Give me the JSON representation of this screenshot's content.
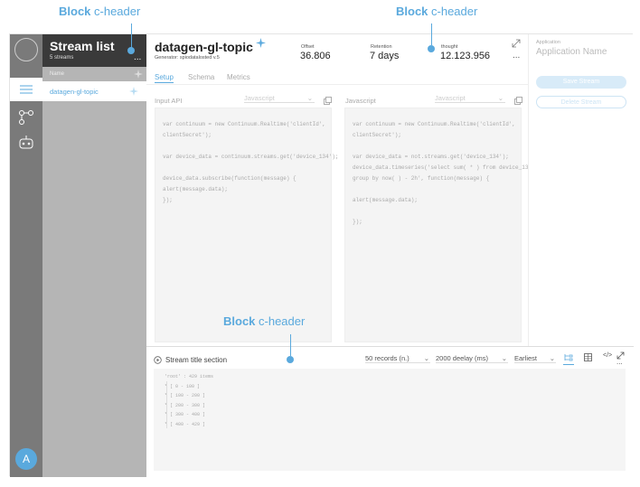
{
  "annotations": {
    "block_label_1": {
      "strong": "Block",
      "rest": " c-header"
    },
    "block_label_2": {
      "strong": "Block",
      "rest": " c-header"
    },
    "block_label_3": {
      "strong": "Block",
      "rest": " c-header"
    }
  },
  "rail": {
    "avatar_letter": "A"
  },
  "sidebar": {
    "title": "Stream list",
    "count": "5 streams",
    "more": "...",
    "column_header": "Name",
    "items": [
      {
        "label": "datagen-gl-topic"
      }
    ]
  },
  "header": {
    "topic": "datagen-gl-topic",
    "generator": "Generator: spiodatalosted v.5",
    "stats": [
      {
        "label": "Offset",
        "value": "36.806"
      },
      {
        "label": "Retention",
        "value": "7 days"
      },
      {
        "label": "thought",
        "value": "12.123.956"
      }
    ],
    "more": "..."
  },
  "tabs": [
    {
      "label": "Setup",
      "active": true
    },
    {
      "label": "Schema",
      "active": false
    },
    {
      "label": "Metrics",
      "active": false
    }
  ],
  "input_panel": {
    "label": "Input API",
    "language": "Javascript",
    "code": [
      "var continuum = new Continuum.Realtime('clientId',",
      "clientSecret');",
      "",
      "var device_data = continuum.streams.get('device_134');",
      "",
      "device_data.subscribe(function(message) {",
      "  alert(message.data);",
      "});"
    ]
  },
  "output_panel": {
    "label": "Javascript",
    "language": "Javascript",
    "code": [
      "var continuum = new Continuum.Realtime('clientId',",
      "clientSecret');",
      "",
      "var device_data = not.streams.get('device_134');",
      "device_data.timeseries('select sum( * ) from device_134",
      "group by now( ) - 2h', function(message) {",
      "",
      "  alert(message.data);",
      "",
      "});"
    ]
  },
  "right_panel": {
    "app_label": "Application",
    "app_placeholder": "Application Name",
    "save_label": "Save Stream",
    "delete_label": "Delete Stream"
  },
  "stream_section": {
    "title": "Stream title section",
    "records_select": "50 records (n.)",
    "delay_select": "2000 deelay (ms)",
    "offset_select": "Earliest",
    "tree": [
      "'root' :  429 items",
      "  * [ 0 - 100 ]",
      "  * [ 100 - 200 ]",
      "  * [ 200 - 300 ]",
      "  * [ 300 - 400 ]",
      "  * [ 400 - 429 ]"
    ],
    "more": "..."
  },
  "colors": {
    "accent": "#5aa9dd",
    "rail": "#7a7a7a",
    "sidebar": "#b5b5b5",
    "sidebar_header": "#3a3a3a"
  }
}
